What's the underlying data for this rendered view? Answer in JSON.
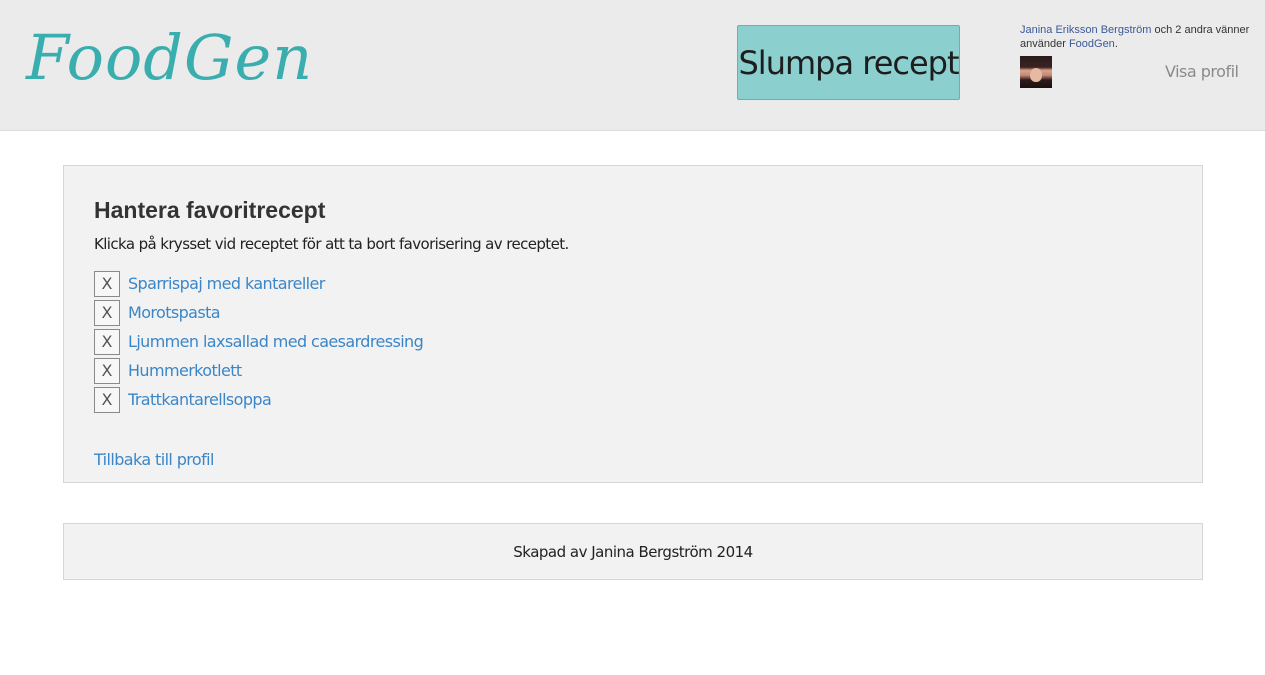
{
  "header": {
    "logo": "FoodGen",
    "random_button": "Slumpa recept",
    "social": {
      "friend_name": "Janina Eriksson Bergström",
      "middle_text": " och 2 andra vänner använder ",
      "app_name": "FoodGen",
      "end_text": "."
    },
    "profile_link": "Visa profil"
  },
  "main": {
    "title": "Hantera favoritrecept",
    "instruction": "Klicka på krysset vid receptet för att ta bort favorisering av receptet.",
    "remove_label": "X",
    "favorites": [
      "Sparrispaj med kantareller",
      "Morotspasta",
      "Ljummen laxsallad med caesardressing",
      "Hummerkotlett",
      "Trattkantarellsoppa"
    ],
    "back_link": "Tillbaka till profil"
  },
  "footer": {
    "text": "Skapad av Janina Bergström 2014"
  },
  "colors": {
    "accent": "#8ccfcf",
    "logo": "#3aaeae",
    "link": "#3a86c8",
    "header_bg": "#ebebeb",
    "panel_bg": "#f2f2f2"
  }
}
